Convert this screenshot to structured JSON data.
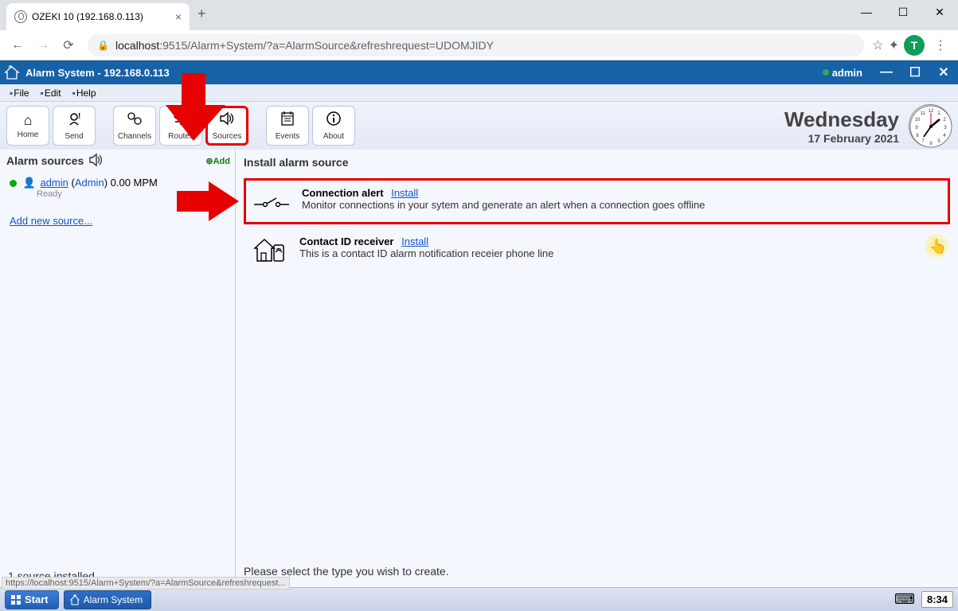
{
  "browser": {
    "tab_title": "OZEKI 10 (192.168.0.113)",
    "url_host": "localhost",
    "url_port_path": ":9515/Alarm+System/?a=AlarmSource&refreshrequest=UDOMJIDY",
    "profile_initial": "T"
  },
  "app": {
    "title": "Alarm System - 192.168.0.113",
    "user": "admin"
  },
  "menu": {
    "file": "File",
    "edit": "Edit",
    "help": "Help"
  },
  "toolbar": {
    "home": "Home",
    "send": "Send",
    "channels": "Channels",
    "routes": "Routes",
    "sources": "Sources",
    "events": "Events",
    "about": "About"
  },
  "datetime": {
    "day": "Wednesday",
    "date": "17 February 2021"
  },
  "left_panel": {
    "header": "Alarm sources",
    "add_label": "Add",
    "src_user": "admin",
    "src_role": "Admin",
    "src_mpm": "0.00 MPM",
    "src_status": "Ready",
    "add_new": "Add new source...",
    "footer": "1 source installed"
  },
  "right_panel": {
    "header": "Install alarm source",
    "items": [
      {
        "title": "Connection alert",
        "link": "Install",
        "desc": "Monitor connections in your sytem and generate an alert when a connection goes offline"
      },
      {
        "title": "Contact ID receiver",
        "link": "Install",
        "desc": "This is a contact ID alarm notification receier phone line"
      }
    ],
    "footer": "Please select the type you wish to create."
  },
  "taskbar": {
    "start": "Start",
    "task1": "Alarm System",
    "time": "8:34",
    "status_url": "https://localhost:9515/Alarm+System/?a=AlarmSource&refreshrequest..."
  }
}
